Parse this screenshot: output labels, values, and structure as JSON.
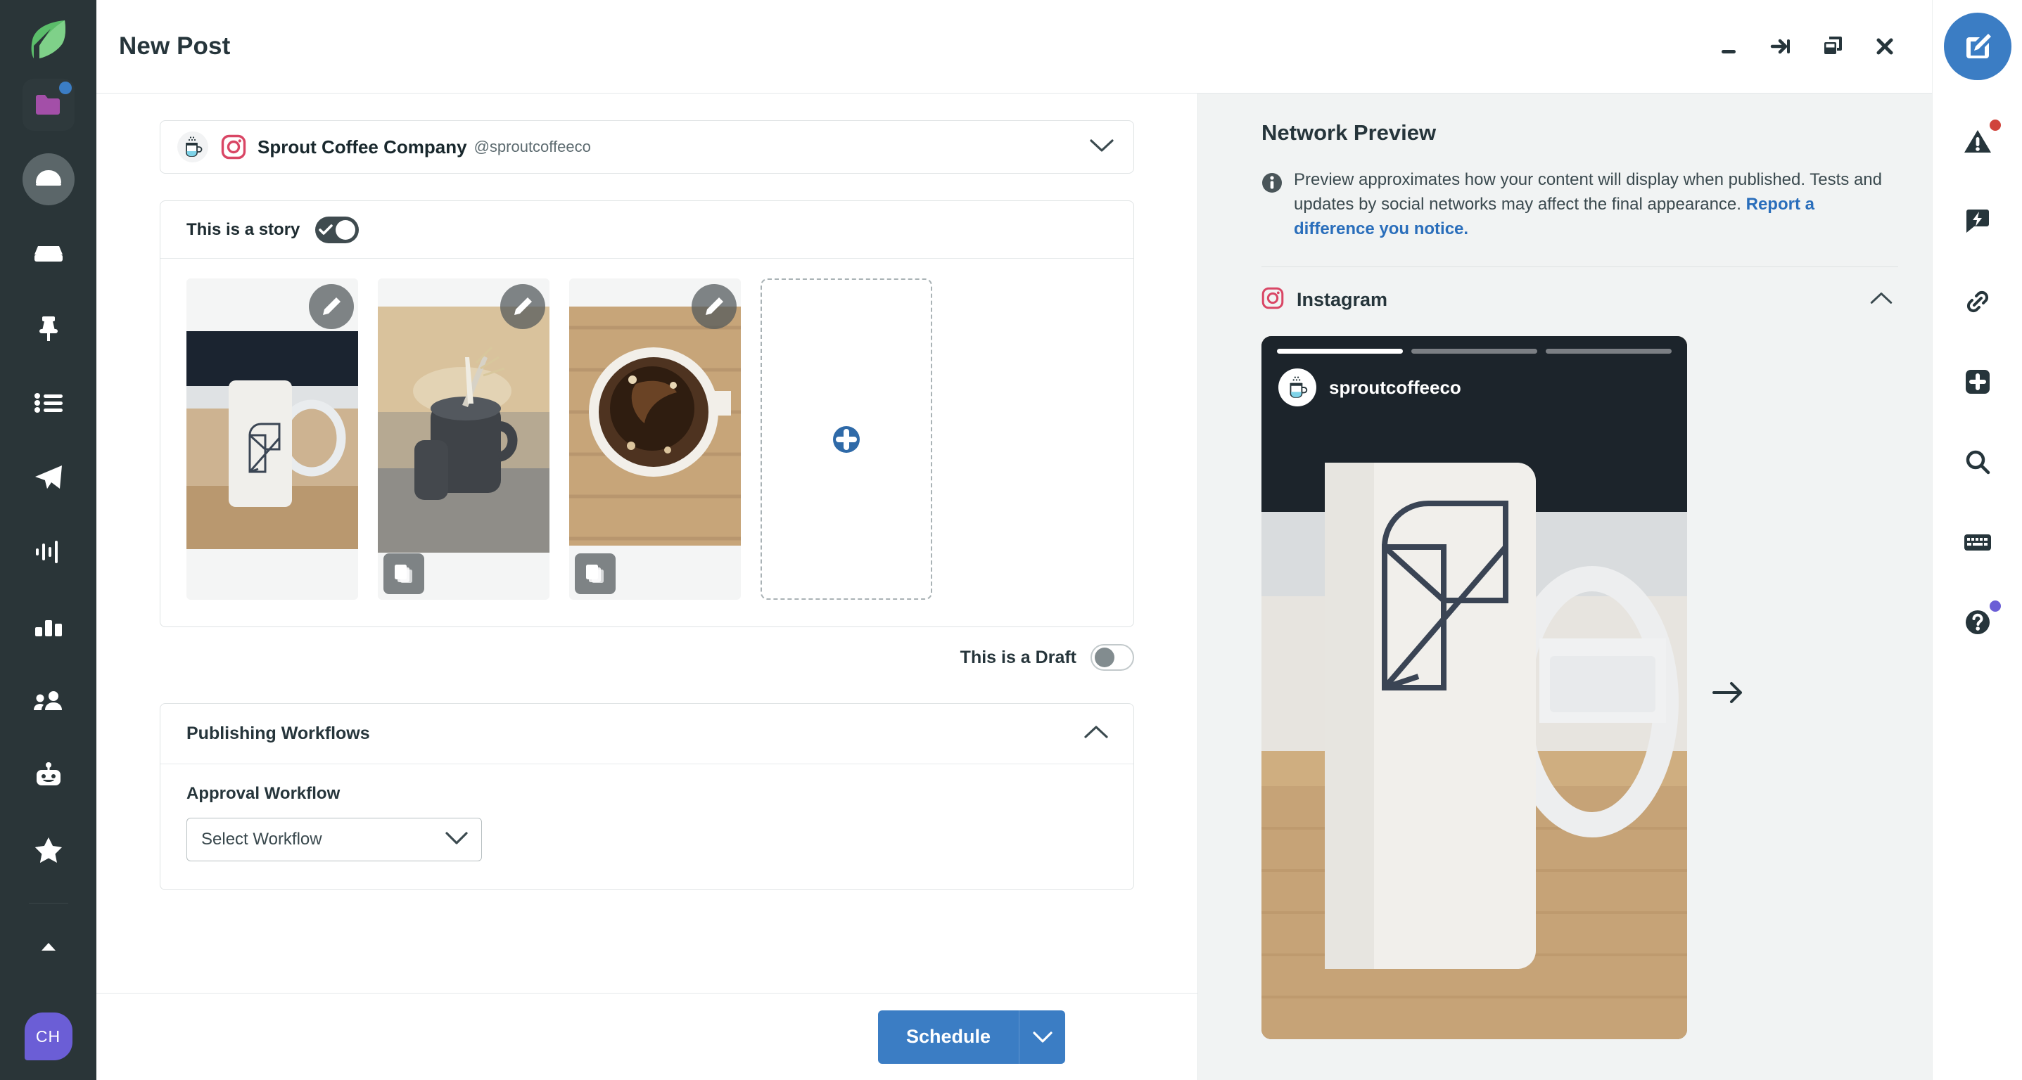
{
  "window": {
    "title": "New Post",
    "controls": [
      {
        "name": "minimize",
        "label": "Minimize"
      },
      {
        "name": "collapse-right",
        "label": "Collapse"
      },
      {
        "name": "restore",
        "label": "Restore"
      },
      {
        "name": "close",
        "label": "Close"
      }
    ]
  },
  "left_rail": {
    "logo": "sprout-social-logo",
    "items": [
      {
        "name": "assets-folder",
        "icon": "folder-icon",
        "badge": true,
        "active": false,
        "boxed": true
      },
      {
        "name": "dashboard",
        "icon": "speedometer-icon",
        "badge": false,
        "active": true,
        "boxed": false
      },
      {
        "name": "inbox",
        "icon": "inbox-tray-icon",
        "badge": false,
        "active": false,
        "boxed": false
      },
      {
        "name": "pinned",
        "icon": "pin-icon",
        "badge": false,
        "active": false,
        "boxed": false
      },
      {
        "name": "tasks",
        "icon": "list-icon",
        "badge": false,
        "active": false,
        "boxed": false
      },
      {
        "name": "publishing",
        "icon": "paper-plane-icon",
        "badge": false,
        "active": false,
        "boxed": false
      },
      {
        "name": "listening",
        "icon": "waveform-icon",
        "badge": false,
        "active": false,
        "boxed": false
      },
      {
        "name": "reports",
        "icon": "bar-chart-icon",
        "badge": false,
        "active": false,
        "boxed": false
      },
      {
        "name": "audience",
        "icon": "people-icon",
        "badge": false,
        "active": false,
        "boxed": false
      },
      {
        "name": "bots",
        "icon": "robot-icon",
        "badge": false,
        "active": false,
        "boxed": false
      },
      {
        "name": "reviews",
        "icon": "star-half-icon",
        "badge": false,
        "active": false,
        "boxed": false
      }
    ],
    "avatar_initials": "CH"
  },
  "right_rail": {
    "compose_icon": "compose-pencil-icon",
    "items": [
      {
        "name": "alerts",
        "icon": "warning-triangle-icon",
        "dot": "#d0433b"
      },
      {
        "name": "quick-chat",
        "icon": "lightning-chat-icon",
        "dot": null
      },
      {
        "name": "links",
        "icon": "link-chain-icon",
        "dot": null
      },
      {
        "name": "add",
        "icon": "plus-square-icon",
        "dot": null
      },
      {
        "name": "search",
        "icon": "search-icon",
        "dot": null
      },
      {
        "name": "shortcuts",
        "icon": "keyboard-icon",
        "dot": null
      },
      {
        "name": "help",
        "icon": "question-circle-icon",
        "dot": "#6b5ed6"
      }
    ]
  },
  "composer": {
    "profile": {
      "avatar_icon": "coffee-cup-icon",
      "network_icon": "instagram-icon",
      "name": "Sprout Coffee Company",
      "handle": "@sproutcoffeeco",
      "chevron": "chevron-down-icon"
    },
    "story_toggle": {
      "label": "This is a story",
      "state": "on"
    },
    "media": {
      "thumbnails": [
        {
          "name": "media-thumb-1",
          "alt": "White mug with leaf logo on a wooden desk",
          "has_carousel_badge": false,
          "edit_icon": "pencil-icon"
        },
        {
          "name": "media-thumb-2",
          "alt": "Dark mug with striped straw and wheat",
          "has_carousel_badge": true,
          "edit_icon": "pencil-icon"
        },
        {
          "name": "media-thumb-3",
          "alt": "Top-down cup of black coffee on wood",
          "has_carousel_badge": true,
          "edit_icon": "pencil-icon"
        }
      ],
      "add_slot": {
        "name": "add-media-slot",
        "icon": "plus-circle-icon"
      }
    },
    "draft_toggle": {
      "label": "This is a Draft",
      "state": "off"
    },
    "workflows": {
      "section_title": "Publishing Workflows",
      "collapse_icon": "chevron-up-icon",
      "field_label": "Approval Workflow",
      "select_value": "Select Workflow",
      "select_chevron": "chevron-down-icon"
    },
    "actions": {
      "primary_label": "Schedule",
      "split_icon": "chevron-down-icon",
      "primary_color": "#3b7dc4"
    }
  },
  "preview": {
    "title": "Network Preview",
    "info_icon": "info-circle-icon",
    "note_text": "Preview approximates how your content will display when published. Tests and updates by social networks may affect the final appearance. ",
    "note_link": "Report a difference you notice.",
    "network": {
      "icon": "instagram-icon",
      "name": "Instagram",
      "collapse_icon": "chevron-up-icon"
    },
    "story": {
      "username": "sproutcoffeeco",
      "avatar_icon": "coffee-cup-icon",
      "progress_segments": 3,
      "active_segment": 1,
      "next_icon": "arrow-right-icon",
      "image_alt": "White mug with leaf logo on a wooden desk"
    }
  }
}
